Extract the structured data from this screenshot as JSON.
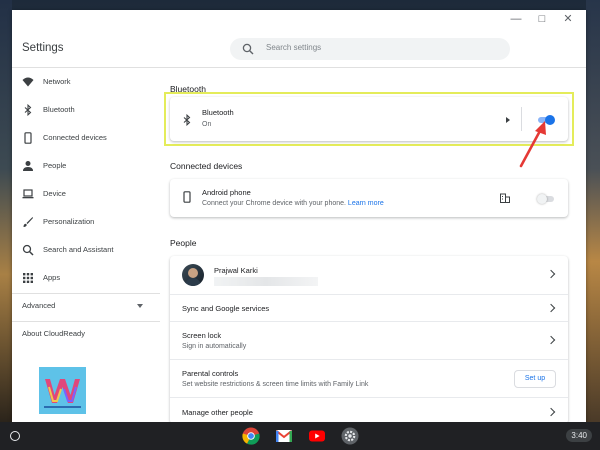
{
  "window": {
    "controls": {
      "minimize": "—",
      "maximize": "□",
      "close": "✕"
    }
  },
  "header": {
    "title": "Settings",
    "search_placeholder": "Search settings"
  },
  "sidebar": {
    "items": [
      {
        "label": "Network",
        "icon": "wifi-icon"
      },
      {
        "label": "Bluetooth",
        "icon": "bluetooth-icon"
      },
      {
        "label": "Connected devices",
        "icon": "phone-icon"
      },
      {
        "label": "People",
        "icon": "person-icon"
      },
      {
        "label": "Device",
        "icon": "laptop-icon"
      },
      {
        "label": "Personalization",
        "icon": "brush-icon"
      },
      {
        "label": "Search and Assistant",
        "icon": "search-icon"
      },
      {
        "label": "Apps",
        "icon": "apps-grid-icon"
      }
    ],
    "advanced": "Advanced",
    "about": "About CloudReady",
    "logo_color": "#5ec2e8"
  },
  "main": {
    "bluetooth": {
      "section_title": "Bluetooth",
      "title": "Bluetooth",
      "status": "On",
      "toggle_on": true
    },
    "connected_devices": {
      "section_title": "Connected devices",
      "title": "Android phone",
      "description": "Connect your Chrome device with your phone.",
      "learn_more": "Learn more",
      "toggle_on": false
    },
    "people": {
      "section_title": "People",
      "user_name": "Prajwal Karki",
      "rows": [
        {
          "title": "Sync and Google services"
        },
        {
          "title": "Screen lock",
          "sub": "Sign in automatically"
        },
        {
          "title": "Parental controls",
          "sub": "Set website restrictions & screen time limits with Family Link",
          "button": "Set up"
        },
        {
          "title": "Manage other people"
        }
      ]
    }
  },
  "shelf": {
    "apps": [
      "chrome-icon",
      "gmail-icon",
      "youtube-icon",
      "settings-icon"
    ],
    "time": "3:40"
  },
  "colors": {
    "accent": "#1a73e8",
    "highlight_box": "#e4ec5a",
    "annotation_arrow": "#e53935"
  }
}
